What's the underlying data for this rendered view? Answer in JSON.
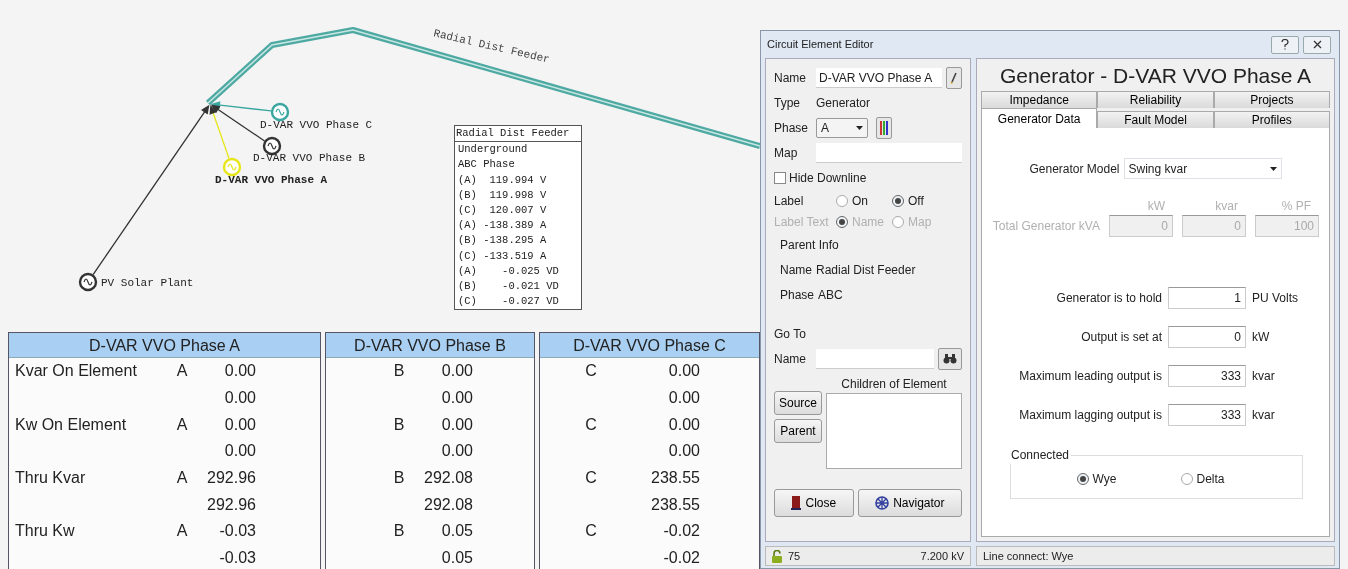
{
  "diagram": {
    "feeder_label": "Radial Dist Feeder",
    "nodes": [
      {
        "label": "D-VAR VVO Phase C",
        "color": "#3aa6a0",
        "selected": false
      },
      {
        "label": "D-VAR VVO Phase B",
        "color": "#333333",
        "selected": false
      },
      {
        "label": "D-VAR VVO Phase A",
        "color": "#e6e61a",
        "selected": true
      },
      {
        "label": "PV Solar Plant",
        "color": "#333333",
        "selected": false
      }
    ],
    "info_box": {
      "title": "Radial Dist Feeder",
      "lines": [
        "Underground",
        "ABC Phase",
        "(A)  119.994 V",
        "(B)  119.998 V",
        "(C)  120.007 V",
        "(A) -138.389 A",
        "(B) -138.295 A",
        "(C) -133.519 A",
        "(A)    -0.025 VD",
        "(B)    -0.021 VD",
        "(C)    -0.027 VD"
      ]
    }
  },
  "panels": [
    {
      "title": "D-VAR VVO Phase A",
      "rows": [
        {
          "label": "Kvar On Element",
          "phase": "A",
          "values": [
            "0.00",
            "0.00"
          ]
        },
        {
          "label": "Kw On Element",
          "phase": "A",
          "values": [
            "0.00",
            "0.00"
          ]
        },
        {
          "label": "Thru Kvar",
          "phase": "A",
          "values": [
            "292.96",
            "292.96"
          ]
        },
        {
          "label": "Thru Kw",
          "phase": "A",
          "values": [
            "-0.03",
            "-0.03"
          ]
        }
      ]
    },
    {
      "title": "D-VAR VVO Phase B",
      "rows": [
        {
          "phase": "B",
          "values": [
            "0.00",
            "0.00"
          ]
        },
        {
          "phase": "B",
          "values": [
            "0.00",
            "0.00"
          ]
        },
        {
          "phase": "B",
          "values": [
            "292.08",
            "292.08"
          ]
        },
        {
          "phase": "B",
          "values": [
            "0.05",
            "0.05"
          ]
        }
      ]
    },
    {
      "title": "D-VAR VVO Phase C",
      "rows": [
        {
          "phase": "C",
          "values": [
            "0.00",
            "0.00"
          ]
        },
        {
          "phase": "C",
          "values": [
            "0.00",
            "0.00"
          ]
        },
        {
          "phase": "C",
          "values": [
            "238.55",
            "238.55"
          ]
        },
        {
          "phase": "C",
          "values": [
            "-0.02",
            "-0.02"
          ]
        }
      ]
    }
  ],
  "dialog": {
    "title": "Circuit Element Editor",
    "name": {
      "label": "Name",
      "value": "D-VAR VVO Phase A"
    },
    "type": {
      "label": "Type",
      "value": "Generator"
    },
    "phase": {
      "label": "Phase",
      "value": "A"
    },
    "map": {
      "label": "Map"
    },
    "hide_downline": {
      "label": "Hide Downline",
      "checked": false
    },
    "label_option": {
      "label": "Label",
      "options": [
        {
          "label": "On",
          "selected": false
        },
        {
          "label": "Off",
          "selected": true
        }
      ]
    },
    "label_text": {
      "label": "Label Text",
      "disabled": true,
      "options": [
        {
          "label": "Name",
          "selected": true
        },
        {
          "label": "Map",
          "selected": false
        }
      ]
    },
    "parent_info": {
      "title": "Parent Info",
      "name_label": "Name",
      "name": "Radial Dist Feeder",
      "phase_label": "Phase",
      "phase": "ABC"
    },
    "goto": {
      "title": "Go To",
      "name_label": "Name",
      "children_label": "Children of Element"
    },
    "nav_buttons": [
      "Source",
      "Parent"
    ],
    "bottom_buttons": [
      {
        "kind": "close",
        "label": "Close"
      },
      {
        "kind": "navigator",
        "label": "Navigator"
      }
    ],
    "status": {
      "count": "75",
      "voltage": "7.200 kV",
      "connection": "Line connect: Wye"
    },
    "heading": "Generator - D-VAR VVO Phase A",
    "tab_rows": [
      {
        "tabs": [
          {
            "label": "Impedance",
            "selected": false
          },
          {
            "label": "Reliability",
            "selected": false
          },
          {
            "label": "Projects",
            "selected": false
          }
        ]
      },
      {
        "tabs": [
          {
            "label": "Generator Data",
            "selected": true
          },
          {
            "label": "Fault Model",
            "selected": false
          },
          {
            "label": "Profiles",
            "selected": false
          }
        ]
      }
    ],
    "generator_model": {
      "label": "Generator Model",
      "value": "Swing kvar"
    },
    "total_kva": {
      "label": "Total Generator kVA",
      "disabled": true,
      "columns": [
        {
          "header": "kW",
          "value": "0"
        },
        {
          "header": "kvar",
          "value": "0"
        },
        {
          "header": "% PF",
          "value": "100"
        }
      ]
    },
    "settings": [
      {
        "label": "Generator is to hold",
        "value": "1",
        "unit": "PU Volts"
      },
      {
        "label": "Output is set at",
        "value": "0",
        "unit": "kW"
      },
      {
        "label": "Maximum leading output is",
        "value": "333",
        "unit": "kvar"
      },
      {
        "label": "Maximum lagging output is",
        "value": "333",
        "unit": "kvar"
      }
    ],
    "connected": {
      "title": "Connected",
      "options": [
        {
          "label": "Wye",
          "selected": true
        },
        {
          "label": "Delta",
          "selected": false
        }
      ]
    }
  }
}
